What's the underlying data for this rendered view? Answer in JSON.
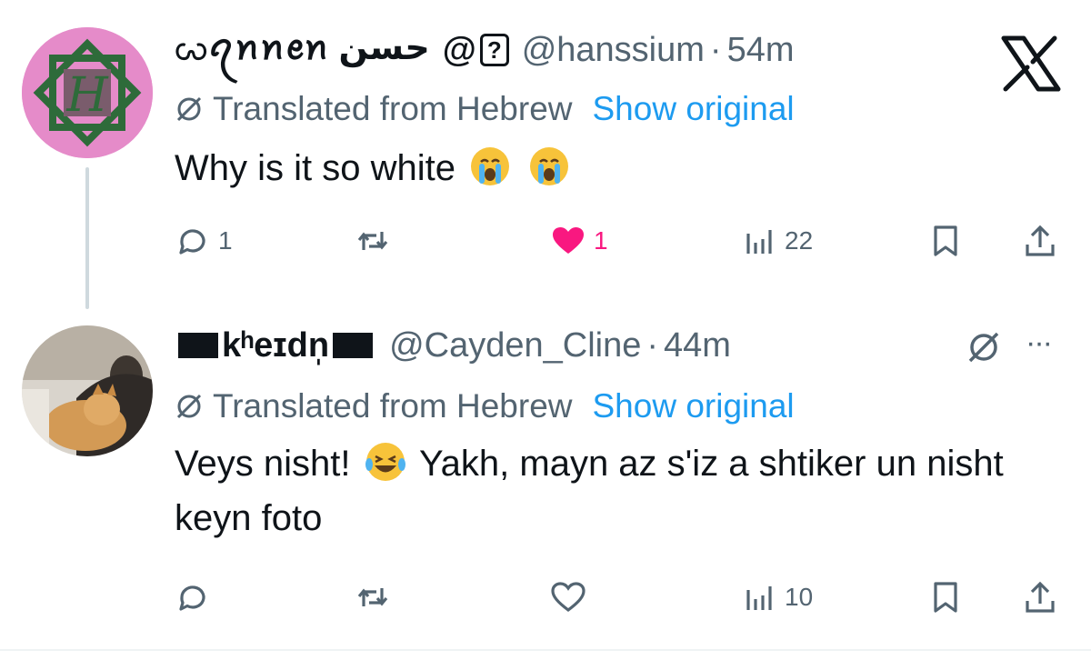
{
  "tweets": [
    {
      "display_name": "ꩬꪖꪀꪀꫀꪀ حسن",
      "badge_prefix": "@",
      "badge": "?",
      "handle": "@hanssium",
      "dot": "·",
      "time": "54m",
      "translated_label": "Translated from Hebrew",
      "show_original": "Show original",
      "text_parts": [
        "Why is it so white",
        "",
        ""
      ],
      "emojis": [
        "crying-face-emoji",
        "crying-face-emoji"
      ],
      "reply_count": "1",
      "retweet_count": "",
      "like_count": "1",
      "liked": true,
      "view_count": "22"
    },
    {
      "display_name": "kʰeɪdn̩",
      "handle": "@Cayden_Cline",
      "dot": "·",
      "time": "44m",
      "translated_label": "Translated from Hebrew",
      "show_original": "Show original",
      "text_before_emoji": "Veys nisht!",
      "text_after_emoji": "Yakh, mayn az s'iz a shtiker un nisht keyn foto",
      "emojis": [
        "laughing-tears-emoji"
      ],
      "reply_count": "",
      "retweet_count": "",
      "like_count": "",
      "liked": false,
      "view_count": "10",
      "more_label": "···"
    }
  ],
  "colors": {
    "text": "#0f1419",
    "secondary": "#536471",
    "link": "#1d9bf0",
    "like": "#f91880",
    "avatar1_bg": "#e58bc9",
    "avatar1_symbol": "#2e6b3a"
  },
  "icons": [
    "x-logo-icon",
    "reply-icon",
    "retweet-icon",
    "like-icon",
    "views-icon",
    "bookmark-icon",
    "share-icon",
    "grok-translate-icon",
    "more-icon"
  ]
}
